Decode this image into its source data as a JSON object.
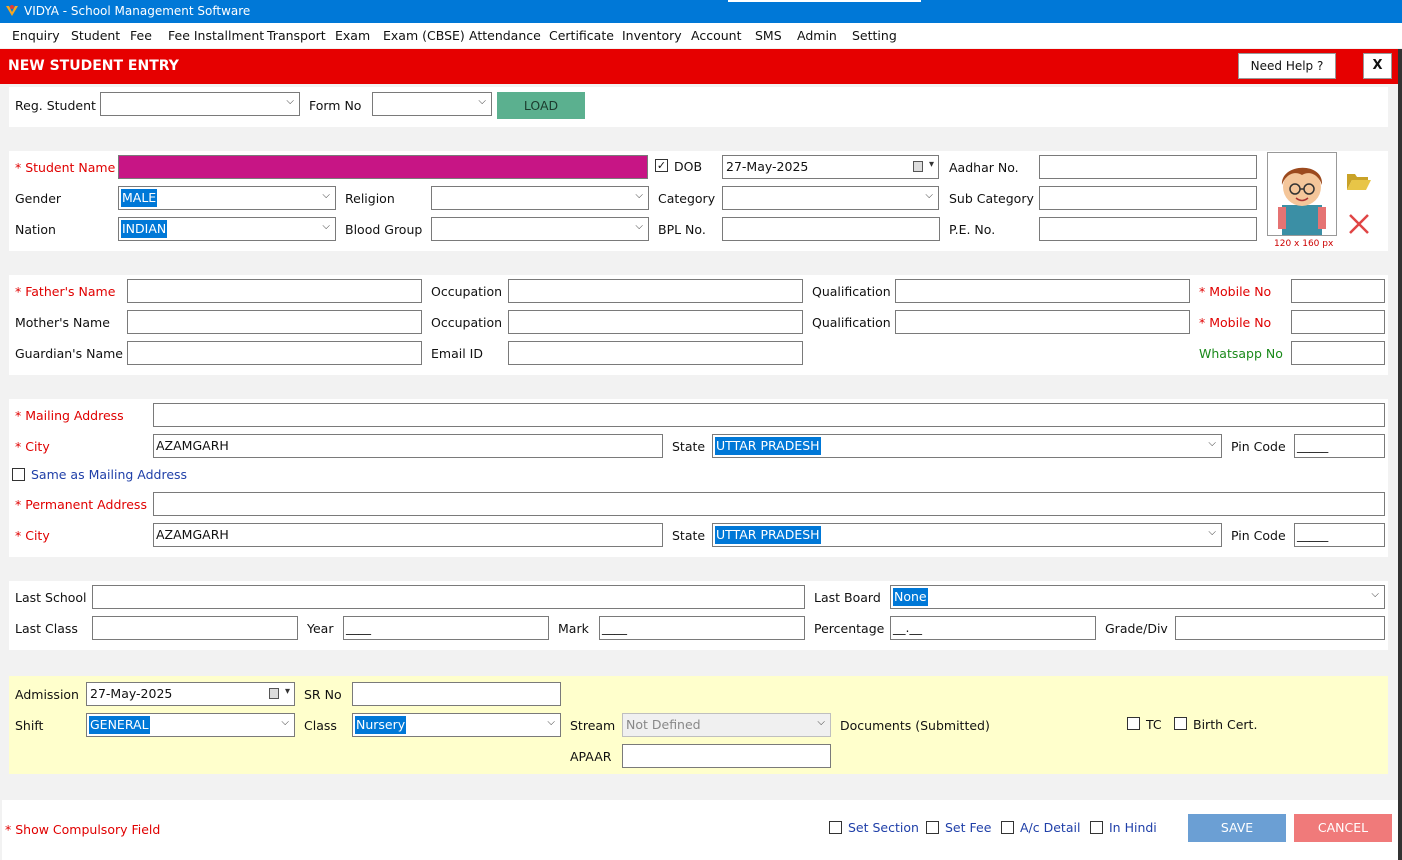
{
  "app": {
    "title": "VIDYA - School Management Software"
  },
  "menu": [
    "Enquiry",
    "Student",
    "Fee",
    "Fee Installment",
    "Transport",
    "Exam",
    "Exam (CBSE)",
    "Attendance",
    "Certificate",
    "Inventory",
    "Account",
    "SMS",
    "Admin",
    "Setting"
  ],
  "header": {
    "title": "NEW STUDENT ENTRY",
    "help": "Need Help ?",
    "close": "X"
  },
  "load_bar": {
    "reg_label": "Reg. Student",
    "form_label": "Form No",
    "load_button": "LOAD"
  },
  "student": {
    "name_label": "* Student Name",
    "dob_label": "DOB",
    "dob_value": "27-May-2025",
    "aadhar_label": "Aadhar No.",
    "gender_label": "Gender",
    "gender_value": "MALE",
    "religion_label": "Religion",
    "category_label": "Category",
    "subcategory_label": "Sub Category",
    "nation_label": "Nation",
    "nation_value": "INDIAN",
    "blood_label": "Blood Group",
    "bpl_label": "BPL No.",
    "pe_label": "P.E. No.",
    "photo_caption": "120 x 160 px"
  },
  "parents": {
    "father_label": "* Father's Name",
    "mother_label": "Mother's Name",
    "guardian_label": "Guardian's Name",
    "occupation_label": "Occupation",
    "email_label": "Email ID",
    "qualification_label": "Qualification",
    "mobile1_label": "* Mobile  No",
    "mobile2_label": "* Mobile No",
    "whatsapp_label": "Whatsapp No"
  },
  "address": {
    "mailing_label": "* Mailing Address",
    "city_label": "* City",
    "city_value": "AZAMGARH",
    "state_label": "State",
    "state_value": "UTTAR PRADESH",
    "pin_label": "Pin Code",
    "pin_value": "_____",
    "same_label": "Same as Mailing Address",
    "permanent_label": "* Permanent Address"
  },
  "previous": {
    "school_label": "Last School",
    "board_label": "Last Board",
    "board_value": "None",
    "class_label": "Last Class",
    "year_label": "Year",
    "year_value": "____",
    "mark_label": "Mark",
    "mark_value": "____",
    "percent_label": "Percentage",
    "percent_value": "__.__",
    "grade_label": "Grade/Div"
  },
  "admission": {
    "admission_label": "Admission",
    "admission_value": "27-May-2025",
    "sr_label": "SR No",
    "shift_label": "Shift",
    "shift_value": "GENERAL",
    "class_label": "Class",
    "class_value": "Nursery",
    "stream_label": "Stream",
    "stream_value": "Not Defined",
    "apaar_label": "APAAR",
    "docs_label": "Documents (Submitted)",
    "tc_label": "TC",
    "birth_label": "Birth Cert."
  },
  "footer": {
    "compulsory": "* Show Compulsory Field",
    "set_section": "Set Section",
    "set_fee": "Set Fee",
    "ac_detail": "A/c Detail",
    "in_hindi": "In Hindi",
    "save": "SAVE",
    "cancel": "CANCEL"
  },
  "colors": {
    "titlebar": "#0078d7",
    "header": "#e60000",
    "name_field": "#c71585",
    "load": "#5bb08f",
    "save": "#6b9fd4",
    "cancel": "#f07a7a"
  }
}
